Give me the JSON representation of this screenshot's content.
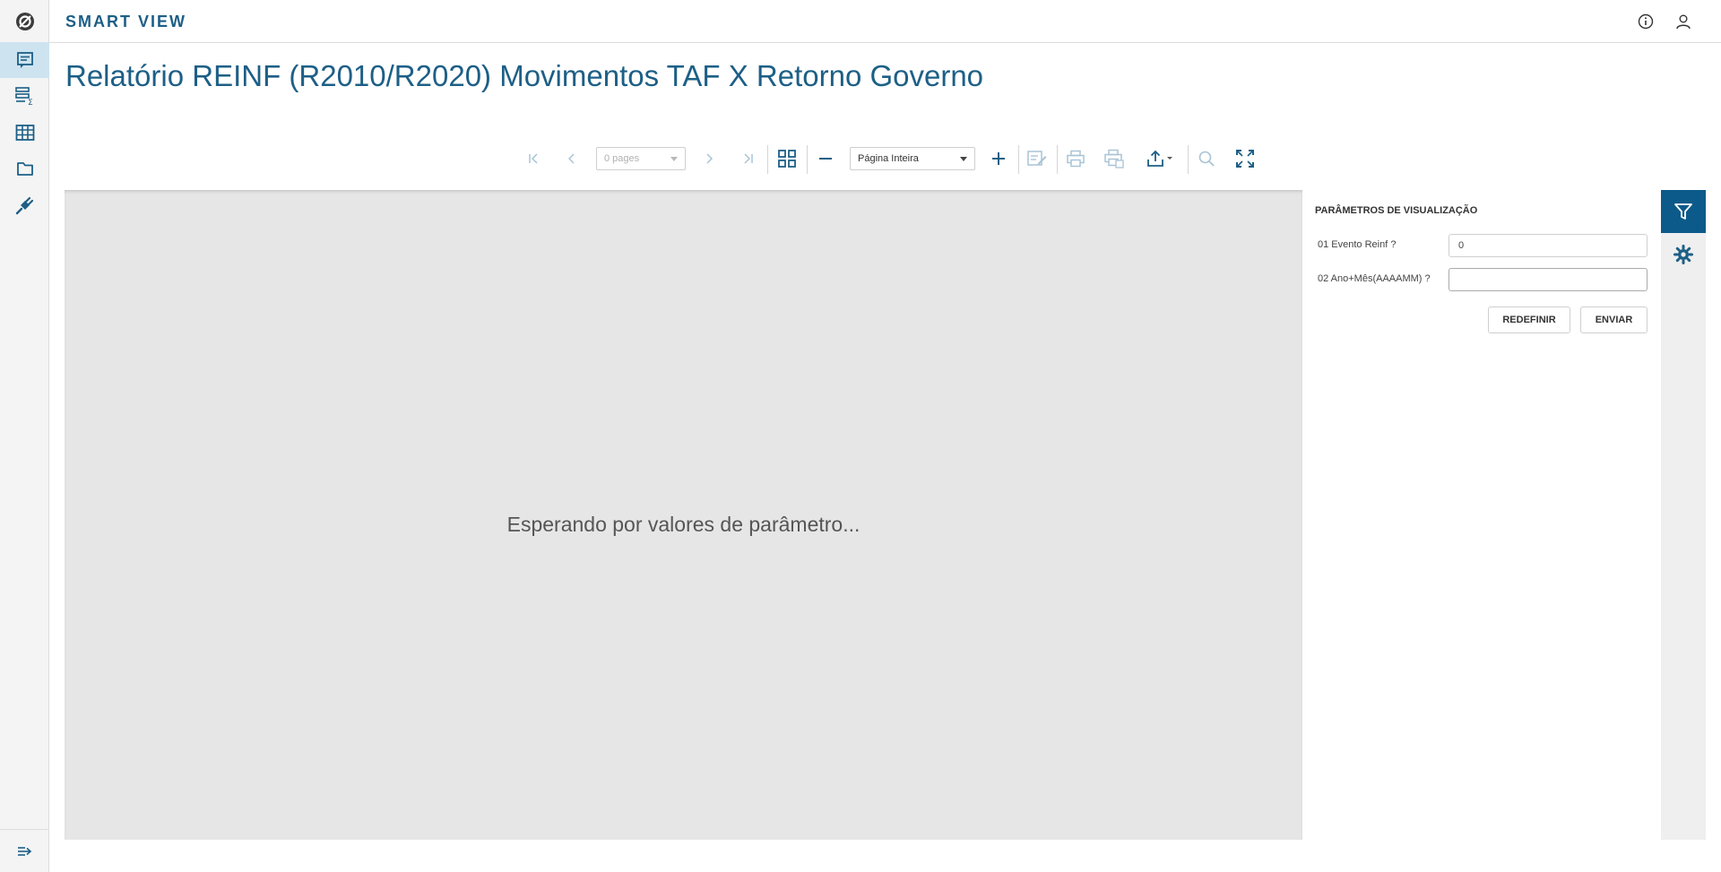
{
  "header": {
    "app_name": "SMART VIEW",
    "icons": [
      "info-icon",
      "user-icon"
    ]
  },
  "sidebar": {
    "items": [
      {
        "name": "reports",
        "icon": "report-icon",
        "active": true
      },
      {
        "name": "data-analysis",
        "icon": "analysis-sum-icon",
        "active": false
      },
      {
        "name": "data-grid",
        "icon": "table-icon",
        "active": false
      },
      {
        "name": "folders",
        "icon": "folder-icon",
        "active": false
      },
      {
        "name": "plugins",
        "icon": "plug-icon",
        "active": false
      }
    ],
    "expand_icon": "expand-menu-icon"
  },
  "page": {
    "title": "Relatório REINF (R2010/R2020) Movimentos TAF X Retorno Governo"
  },
  "toolbar": {
    "pages_value": "0 pages",
    "zoom_value": "Página Inteira"
  },
  "viewer": {
    "message": "Esperando por valores de parâmetro..."
  },
  "params": {
    "title": "PARÂMETROS DE VISUALIZAÇÃO",
    "fields": [
      {
        "label": "01 Evento Reinf ?",
        "value": "0"
      },
      {
        "label": "02 Ano+Mês(AAAAMM) ?",
        "value": ""
      }
    ],
    "reset_label": "REDEFINIR",
    "submit_label": "ENVIAR"
  },
  "colors": {
    "brand": "#1d5f86",
    "active_tab": "#0c5a8a",
    "nav_active": "#cde3f0"
  }
}
